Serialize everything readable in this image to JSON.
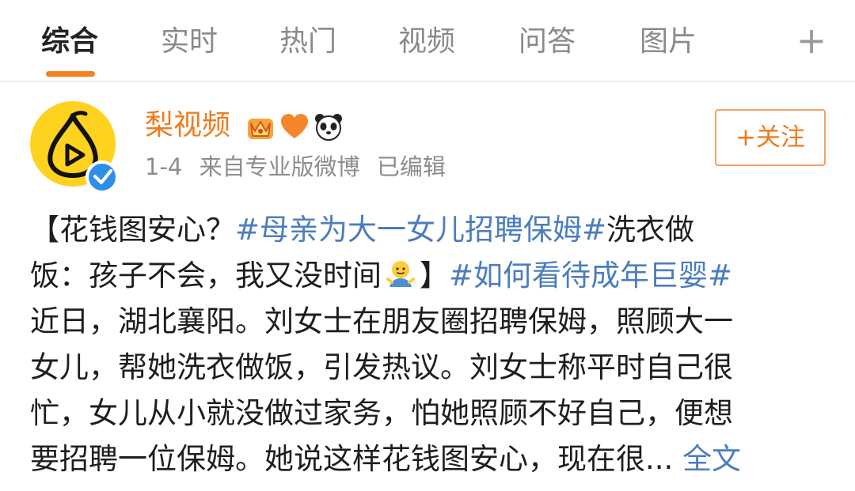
{
  "tabs": [
    {
      "label": "综合",
      "active": true
    },
    {
      "label": "实时",
      "active": false
    },
    {
      "label": "热门",
      "active": false
    },
    {
      "label": "视频",
      "active": false
    },
    {
      "label": "问答",
      "active": false
    },
    {
      "label": "图片",
      "active": false
    }
  ],
  "tab_add_label": "+",
  "post": {
    "author": "梨视频",
    "badges": [
      "crown-badge-icon",
      "orange-heart-icon",
      "panda-icon"
    ],
    "date": "1-4",
    "source": "来自专业版微博",
    "edited": "已编辑",
    "follow_label": "+关注",
    "body": {
      "l1_a": "【花钱图安心？",
      "l1_topic": "#母亲为大一女儿招聘保姆#",
      "l1_b": "洗衣做",
      "l2_a": "饭：孩子不会，我又没时间",
      "l2_b": "】",
      "l2_topic": "#如何看待成年巨婴#",
      "l3": "近日，湖北襄阳。刘女士在朋友圈招聘保姆，照顾大一",
      "l4": "女儿，帮她洗衣做饭，引发热议。刘女士称平时自己很",
      "l5": "忙，女儿从小就没做过家务，怕她照顾不好自己，便想",
      "l6": "要招聘一位保姆。她说这样花钱图安心，现在很...",
      "full_text_label": "全文"
    }
  },
  "colors": {
    "accent": "#f2811f",
    "author": "#f07b1d",
    "link": "#4c7dbd",
    "verified": "#2f8fe8",
    "avatar_bg": "#ffd21f"
  }
}
